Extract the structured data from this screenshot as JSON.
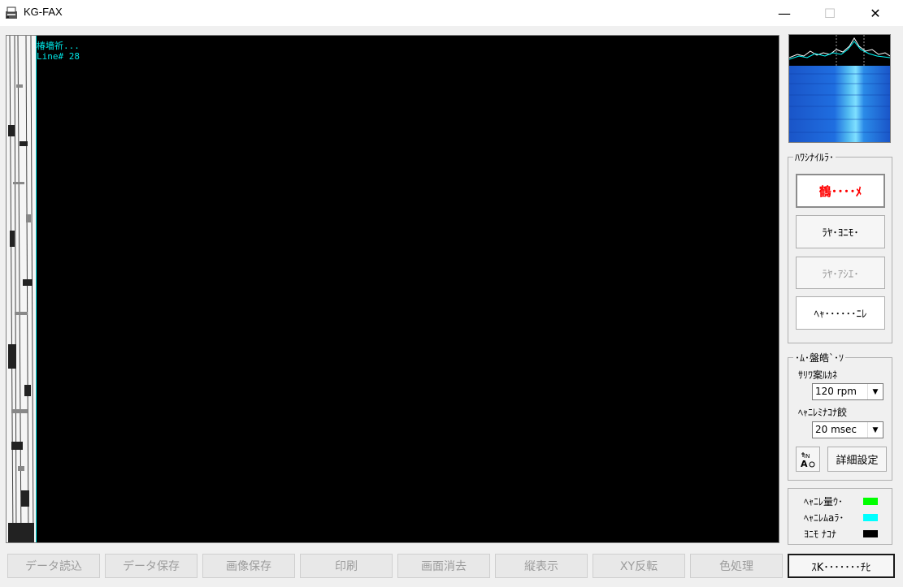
{
  "window": {
    "title": "KG-FAX",
    "icon": "fax-app-icon",
    "min_label": "—",
    "max_label": "☐",
    "close_label": "✕"
  },
  "display": {
    "status_line1": "椿墻祈...",
    "status_line2": "Line# 28"
  },
  "receive_group": {
    "label": "ﾊﾜｼﾅｲﾙﾗ･",
    "buttons": [
      {
        "label": "鶴････ﾒ",
        "state": "active-red"
      },
      {
        "label": "ﾗﾔ･ﾖﾆﾓ･",
        "state": "normal"
      },
      {
        "label": "ﾗﾔ･ｱｼｴ･",
        "state": "disabled"
      },
      {
        "label": "ﾍｬ･･････ﾆﾚ",
        "state": "normal"
      }
    ]
  },
  "settings_group": {
    "label": "･ﾑ･盤皓`･ｿ",
    "speed_label": "ｻﾘﾜ案ﾙｶﾈ",
    "speed_value": "120 rpm",
    "delay_label": "ﾍｬﾆﾚﾐﾅｺﾅ餃",
    "delay_value": "20 msec",
    "detail_button": "詳細設定",
    "tool_icon": "text-format-icon"
  },
  "legend_group": {
    "items": [
      {
        "label": "ﾍｬﾆﾚ量ｳ･",
        "color": "#00ff00"
      },
      {
        "label": "ﾍｬﾆﾚﾑaﾗ･",
        "color": "#00ffff"
      },
      {
        "label": "ﾖﾆﾓ ﾅｺﾅ",
        "color": "#000000"
      }
    ]
  },
  "bottom_bar": {
    "buttons": [
      {
        "label": "データ読込",
        "enabled": false
      },
      {
        "label": "データ保存",
        "enabled": false
      },
      {
        "label": "画像保存",
        "enabled": false
      },
      {
        "label": "印刷",
        "enabled": false
      },
      {
        "label": "画面消去",
        "enabled": false
      },
      {
        "label": "縦表示",
        "enabled": false
      },
      {
        "label": "XY反転",
        "enabled": false
      },
      {
        "label": "色処理",
        "enabled": false
      },
      {
        "label": "ｽK･･･････ﾁﾋ",
        "enabled": true
      }
    ]
  },
  "colors": {
    "accent_text": "#00e6e6",
    "stop_red": "#ff0000"
  }
}
